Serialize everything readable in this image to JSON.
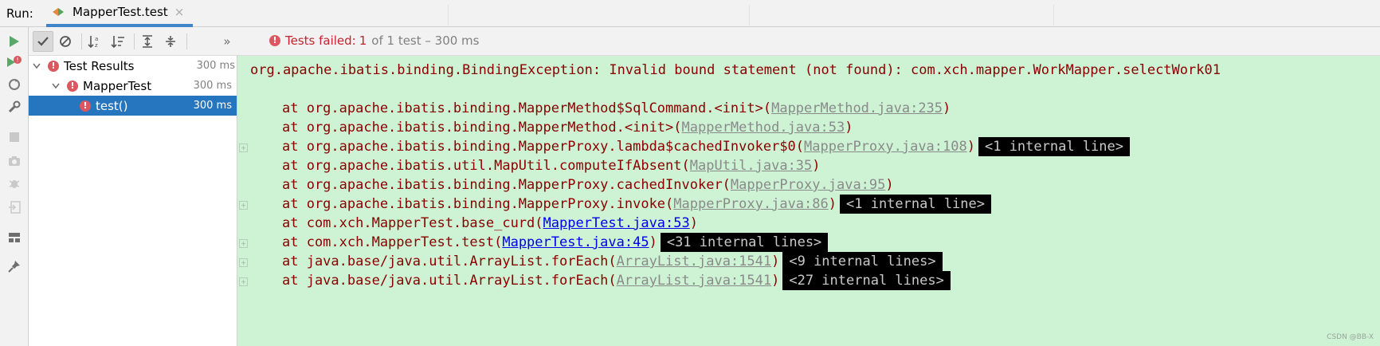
{
  "header": {
    "run_label": "Run:",
    "tab_title": "MapperTest.test",
    "tab_close": "×"
  },
  "toolbar": {
    "status_failed": "Tests failed:",
    "status_count": "1",
    "status_rest": "of 1 test – 300 ms",
    "more_icon": "»"
  },
  "tree": {
    "items": [
      {
        "label": "Test Results",
        "time": "300 ms"
      },
      {
        "label": "MapperTest",
        "time": "300 ms"
      },
      {
        "label": "test()",
        "time": "300 ms"
      }
    ]
  },
  "console": {
    "exception": "org.apache.ibatis.binding.BindingException: Invalid bound statement (not found): com.xch.mapper.WorkMapper.selectWork01",
    "frames": [
      {
        "prefix": "at org.apache.ibatis.binding.MapperMethod$SqlCommand.<init>(",
        "link": "MapperMethod.java:235",
        "suffix": ")",
        "internal": ""
      },
      {
        "prefix": "at org.apache.ibatis.binding.MapperMethod.<init>(",
        "link": "MapperMethod.java:53",
        "suffix": ")",
        "internal": ""
      },
      {
        "prefix": "at org.apache.ibatis.binding.MapperProxy.lambda$cachedInvoker$0(",
        "link": "MapperProxy.java:108",
        "suffix": ")",
        "internal": "<1 internal line>"
      },
      {
        "prefix": "at org.apache.ibatis.util.MapUtil.computeIfAbsent(",
        "link": "MapUtil.java:35",
        "suffix": ")",
        "internal": ""
      },
      {
        "prefix": "at org.apache.ibatis.binding.MapperProxy.cachedInvoker(",
        "link": "MapperProxy.java:95",
        "suffix": ")",
        "internal": ""
      },
      {
        "prefix": "at org.apache.ibatis.binding.MapperProxy.invoke(",
        "link": "MapperProxy.java:86",
        "suffix": ")",
        "internal": "<1 internal line>"
      },
      {
        "prefix": "at com.xch.MapperTest.base_curd(",
        "link": "MapperTest.java:53",
        "suffix": ")",
        "internal": ""
      },
      {
        "prefix": "at com.xch.MapperTest.test(",
        "link": "MapperTest.java:45",
        "suffix": ")",
        "internal": "<31 internal lines>"
      },
      {
        "prefix": "at java.base/java.util.ArrayList.forEach(",
        "link": "ArrayList.java:1541",
        "suffix": ")",
        "internal": "<9 internal lines>"
      },
      {
        "prefix": "at java.base/java.util.ArrayList.forEach(",
        "link": "ArrayList.java:1541",
        "suffix": ")",
        "internal": "<27 internal lines>"
      }
    ],
    "watermark": "CSDN @BB-X"
  },
  "colors": {
    "console_bg": "#cdf2d4",
    "error_text": "#8b0000",
    "selection": "#2675bf",
    "failed": "#c7222d"
  }
}
